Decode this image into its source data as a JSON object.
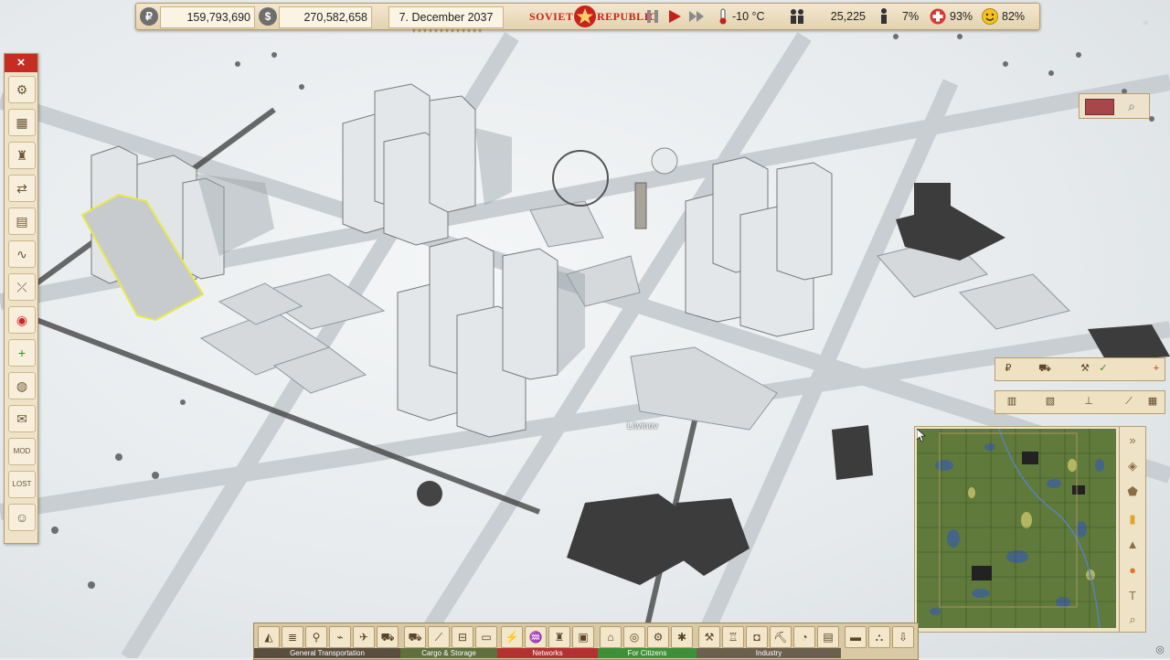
{
  "top_bar": {
    "rubles_icon": "ruble-icon",
    "rubles": "159,793,690",
    "dollars_icon": "dollar-icon",
    "dollars": "270,582,658",
    "date": "7. December 2037",
    "logo_left": "SOVIET",
    "logo_right": "REPUBLIC",
    "temperature": "-10 °C",
    "population": "25,225",
    "unemployment": "7%",
    "health": "93%",
    "happiness": "82%"
  },
  "left_toolbar": {
    "close_label": "×",
    "buttons": [
      "settings",
      "depot",
      "industry",
      "delivery",
      "document",
      "network",
      "route",
      "marker",
      "add-zone",
      "globe",
      "mail",
      "mod",
      "lost",
      "citizen"
    ]
  },
  "town_label": "Litvinov",
  "bottom_toolbar": {
    "groups": [
      {
        "label": "General Transportation",
        "color": "#5a4f3f"
      },
      {
        "label": "Cargo & Storage",
        "color": "#5f6f3e"
      },
      {
        "label": "Networks",
        "color": "#b33131"
      },
      {
        "label": "For Citizens",
        "color": "#3f8f3a"
      },
      {
        "label": "Industry",
        "color": "#6b604d"
      }
    ]
  },
  "minimap_side": {
    "expand_icon": "chevron-right-icon"
  },
  "colors": {
    "panel": "#efe3c7",
    "accent_red": "#c62c24",
    "selection": "#e7e84a"
  }
}
